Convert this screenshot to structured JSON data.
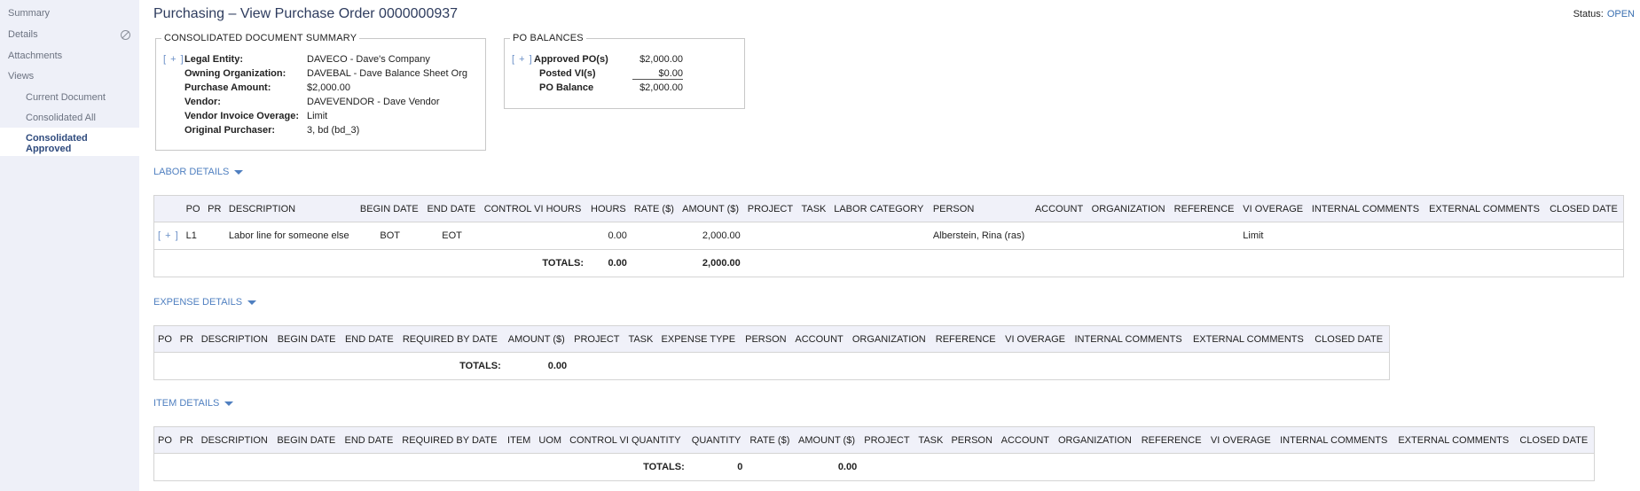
{
  "sidebar": {
    "items": [
      "Summary",
      "Details",
      "Attachments",
      "Views"
    ],
    "views": [
      "Current Document",
      "Consolidated All",
      "Consolidated Approved"
    ]
  },
  "header": {
    "title": "Purchasing – View Purchase Order 0000000937",
    "status_label": "Status:",
    "status_value": "OPEN"
  },
  "summary": {
    "legend": "CONSOLIDATED DOCUMENT SUMMARY",
    "expand": "[ + ]",
    "rows": [
      {
        "label": "Legal Entity:",
        "value": "DAVECO - Dave's Company"
      },
      {
        "label": "Owning Organization:",
        "value": "DAVEBAL - Dave Balance Sheet Org"
      },
      {
        "label": "Purchase Amount:",
        "value": "$2,000.00"
      },
      {
        "label": "Vendor:",
        "value": "DAVEVENDOR - Dave Vendor"
      },
      {
        "label": "Vendor Invoice Overage:",
        "value": "Limit"
      },
      {
        "label": "Original Purchaser:",
        "value": "3, bd (bd_3)"
      }
    ]
  },
  "balances": {
    "legend": "PO BALANCES",
    "expand": "[ + ]",
    "rows": [
      {
        "label": "Approved PO(s)",
        "value": "$2,000.00"
      },
      {
        "label": "Posted VI(s)",
        "value": "$0.00"
      },
      {
        "label": "PO Balance",
        "value": "$2,000.00"
      }
    ]
  },
  "labor": {
    "title": "LABOR DETAILS",
    "headers": [
      "PO",
      "PR",
      "DESCRIPTION",
      "BEGIN DATE",
      "END DATE",
      "CONTROL VI HOURS",
      "HOURS",
      "RATE ($)",
      "AMOUNT ($)",
      "PROJECT",
      "TASK",
      "LABOR CATEGORY",
      "PERSON",
      "ACCOUNT",
      "ORGANIZATION",
      "REFERENCE",
      "VI OVERAGE",
      "INTERNAL COMMENTS",
      "EXTERNAL COMMENTS",
      "CLOSED DATE"
    ],
    "row": {
      "expand": "[ + ]",
      "po": "L1",
      "description": "Labor line for someone else",
      "begin": "BOT",
      "end": "EOT",
      "hours": "0.00",
      "amount": "2,000.00",
      "person": "Alberstein, Rina (ras)",
      "overage": "Limit"
    },
    "totals_label": "TOTALS:",
    "total_hours": "0.00",
    "total_amount": "2,000.00"
  },
  "expense": {
    "title": "EXPENSE DETAILS",
    "headers": [
      "PO",
      "PR",
      "DESCRIPTION",
      "BEGIN DATE",
      "END DATE",
      "REQUIRED BY DATE",
      "AMOUNT ($)",
      "PROJECT",
      "TASK",
      "EXPENSE TYPE",
      "PERSON",
      "ACCOUNT",
      "ORGANIZATION",
      "REFERENCE",
      "VI OVERAGE",
      "INTERNAL COMMENTS",
      "EXTERNAL COMMENTS",
      "CLOSED DATE"
    ],
    "totals_label": "TOTALS:",
    "total_amount": "0.00"
  },
  "item": {
    "title": "ITEM DETAILS",
    "headers": [
      "PO",
      "PR",
      "DESCRIPTION",
      "BEGIN DATE",
      "END DATE",
      "REQUIRED BY DATE",
      "ITEM",
      "UOM",
      "CONTROL VI QUANTITY",
      "QUANTITY",
      "RATE ($)",
      "AMOUNT ($)",
      "PROJECT",
      "TASK",
      "PERSON",
      "ACCOUNT",
      "ORGANIZATION",
      "REFERENCE",
      "VI OVERAGE",
      "INTERNAL COMMENTS",
      "EXTERNAL COMMENTS",
      "CLOSED DATE"
    ],
    "totals_label": "TOTALS:",
    "total_quantity": "0",
    "total_amount": "0.00"
  }
}
